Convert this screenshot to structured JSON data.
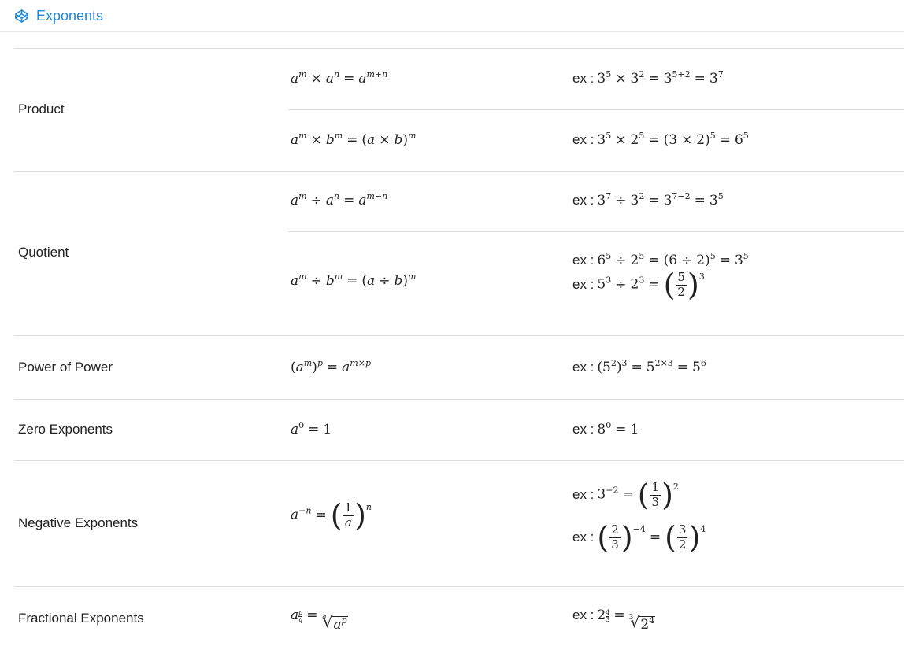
{
  "header": {
    "title": "Exponents",
    "icon": "codepen-icon",
    "accent": "#1f87d6"
  },
  "rows": {
    "product": {
      "label": "Product",
      "r1": {
        "formula": "a^m × a^n = a^{m+n}",
        "example": "3^5 × 3^2 = 3^{5+2} = 3^7"
      },
      "r2": {
        "formula": "a^m × b^m = (a × b)^m",
        "example": "3^5 × 2^5 = (3 × 2)^5 = 6^5"
      }
    },
    "quotient": {
      "label": "Quotient",
      "r1": {
        "formula": "a^m ÷ a^n = a^{m−n}",
        "example": "3^7 ÷ 3^2 = 3^{7−2} = 3^5"
      },
      "r2": {
        "formula": "a^m ÷ b^m = (a ÷ b)^m",
        "example1": "6^5 ÷ 2^5 = (6 ÷ 2)^5 = 3^5",
        "example2": "5^3 ÷ 2^3 = (5/2)^3"
      }
    },
    "power_of_power": {
      "label": "Power of Power",
      "formula": "(a^m)^p = a^{m×p}",
      "example": "(5^2)^3 = 5^{2×3} = 5^6"
    },
    "zero": {
      "label": "Zero Exponents",
      "formula": "a^0 = 1",
      "example": "8^0 = 1"
    },
    "negative": {
      "label": "Negative Exponents",
      "formula": "a^{−n} = (1/a)^n",
      "example1": "3^{−2} = (1/3)^2",
      "example2": "(2/3)^{−4} = (3/2)^4"
    },
    "fractional": {
      "label": "Fractional Exponents",
      "formula": "a^{p/q} = q-th root of a^p",
      "example": "2^{4/3} = cube root of 2^4"
    }
  },
  "ex_prefix": "ex :"
}
